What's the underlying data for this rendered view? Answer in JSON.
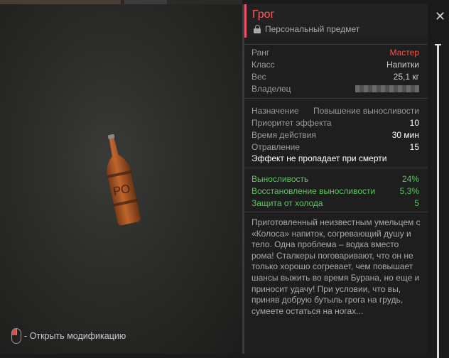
{
  "item": {
    "title": "Грог",
    "subtitle": "Персональный предмет"
  },
  "stats1": [
    {
      "label": "Ранг",
      "value": "Мастер"
    },
    {
      "label": "Класс",
      "value": "Напитки"
    },
    {
      "label": "Вес",
      "value": "25,1 кг"
    },
    {
      "label": "Владелец",
      "value": ""
    }
  ],
  "stats2": {
    "purpose_label": "Назначение",
    "purpose_value": "Повышение выносливости",
    "priority_label": "Приоритет эффекта",
    "priority_value": "10",
    "duration_label": "Время действия",
    "duration_value": "30 мин",
    "poison_label": "Отравление",
    "poison_value": "15",
    "note": "Эффект не пропадает при смерти"
  },
  "effects": [
    {
      "label": "Выносливость",
      "value": "24%"
    },
    {
      "label": "Восстановление выносливости",
      "value": "5,3%"
    },
    {
      "label": "Защита от холода",
      "value": "5"
    }
  ],
  "description": "Приготовленный неизвестным умельцем с «Колоса» напиток, согревающий душу и тело. Одна проблема – водка вместо рома! Сталкеры поговаривают, что он не только хорошо согревает, чем повышает шансы выжить во время Бурана, но еще и приносит удачу! При условии, что вы, приняв добрую бутыль грога на грудь, сумеете остаться на ногах...",
  "hint": "- Открыть модификацию",
  "colors": {
    "accent": "#e8506a",
    "rank": "#ff4f4f",
    "effect": "#58c75a"
  }
}
